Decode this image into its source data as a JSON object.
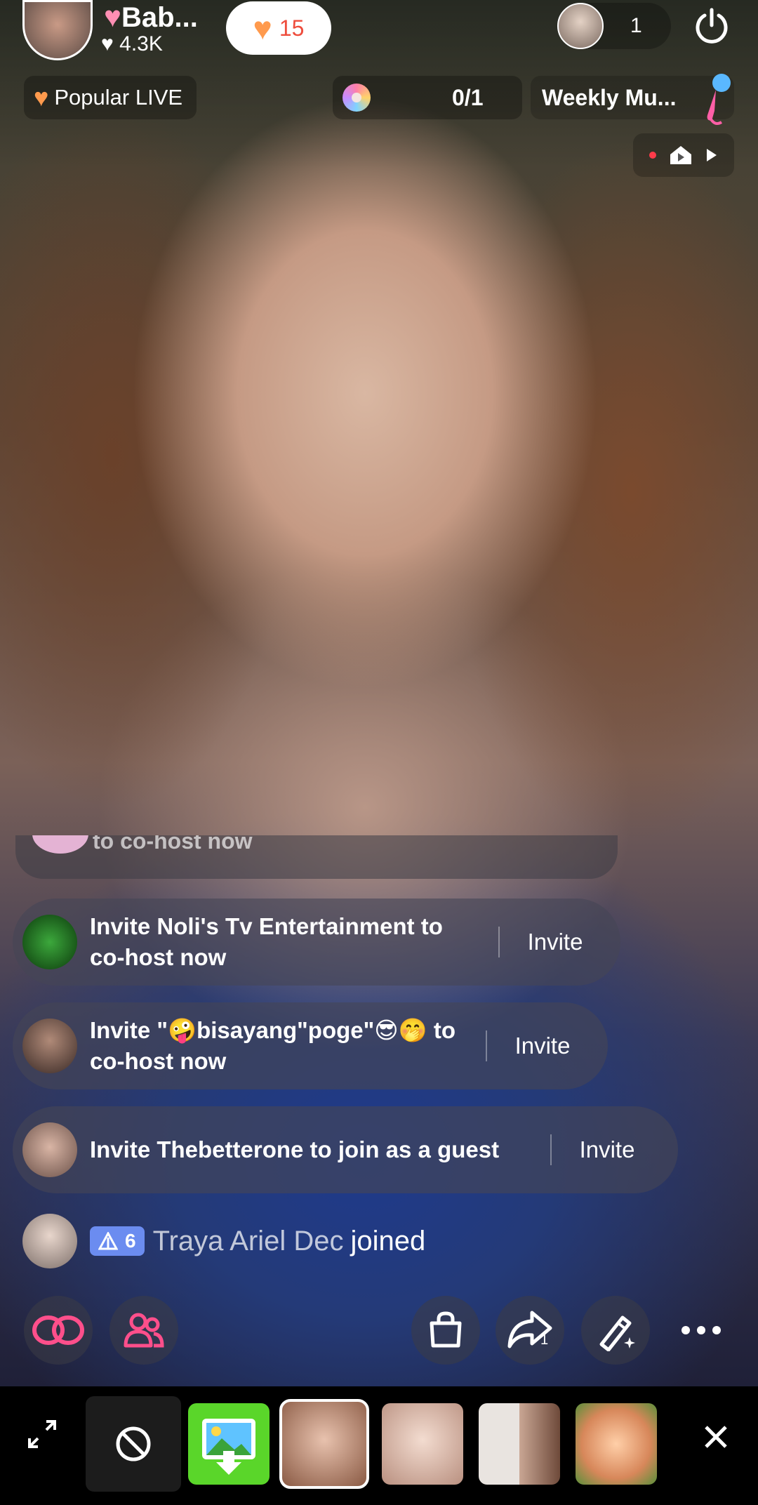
{
  "header": {
    "host_name": "Bab...",
    "host_likes": "4.3K",
    "follow_count": "15",
    "viewer_count": "1",
    "popular_label": "Popular LIVE",
    "goal_progress": "0/1",
    "weekly_label": "Weekly Mu..."
  },
  "chat": {
    "faded_text": "to co-host now",
    "invites": [
      {
        "text": "Invite Noli's Tv Entertainment to co-host now",
        "button": "Invite"
      },
      {
        "text": "Invite \"🤪bisayang\"poge\"😎🤭 to co-host now",
        "button": "Invite"
      },
      {
        "text": "Invite Thebetterone to join as a guest",
        "button": "Invite"
      }
    ],
    "joined": {
      "level": "6",
      "username": "Traya Ariel Dec",
      "action": "joined"
    }
  },
  "actions": {
    "share_count": "1"
  },
  "icons": [
    "power-icon",
    "heart-icon",
    "mic-icon",
    "record-icon",
    "play-icon",
    "link-icon",
    "people-icon",
    "shopping-bag-icon",
    "share-icon",
    "magic-wand-icon",
    "more-icon",
    "expand-icon",
    "no-effect-icon",
    "close-icon"
  ],
  "colors": {
    "follow_text": "#ee4d3d",
    "heart": "#ff9a4d",
    "badge": "#6b8cf0",
    "accent_pink": "#ff4f8b"
  }
}
